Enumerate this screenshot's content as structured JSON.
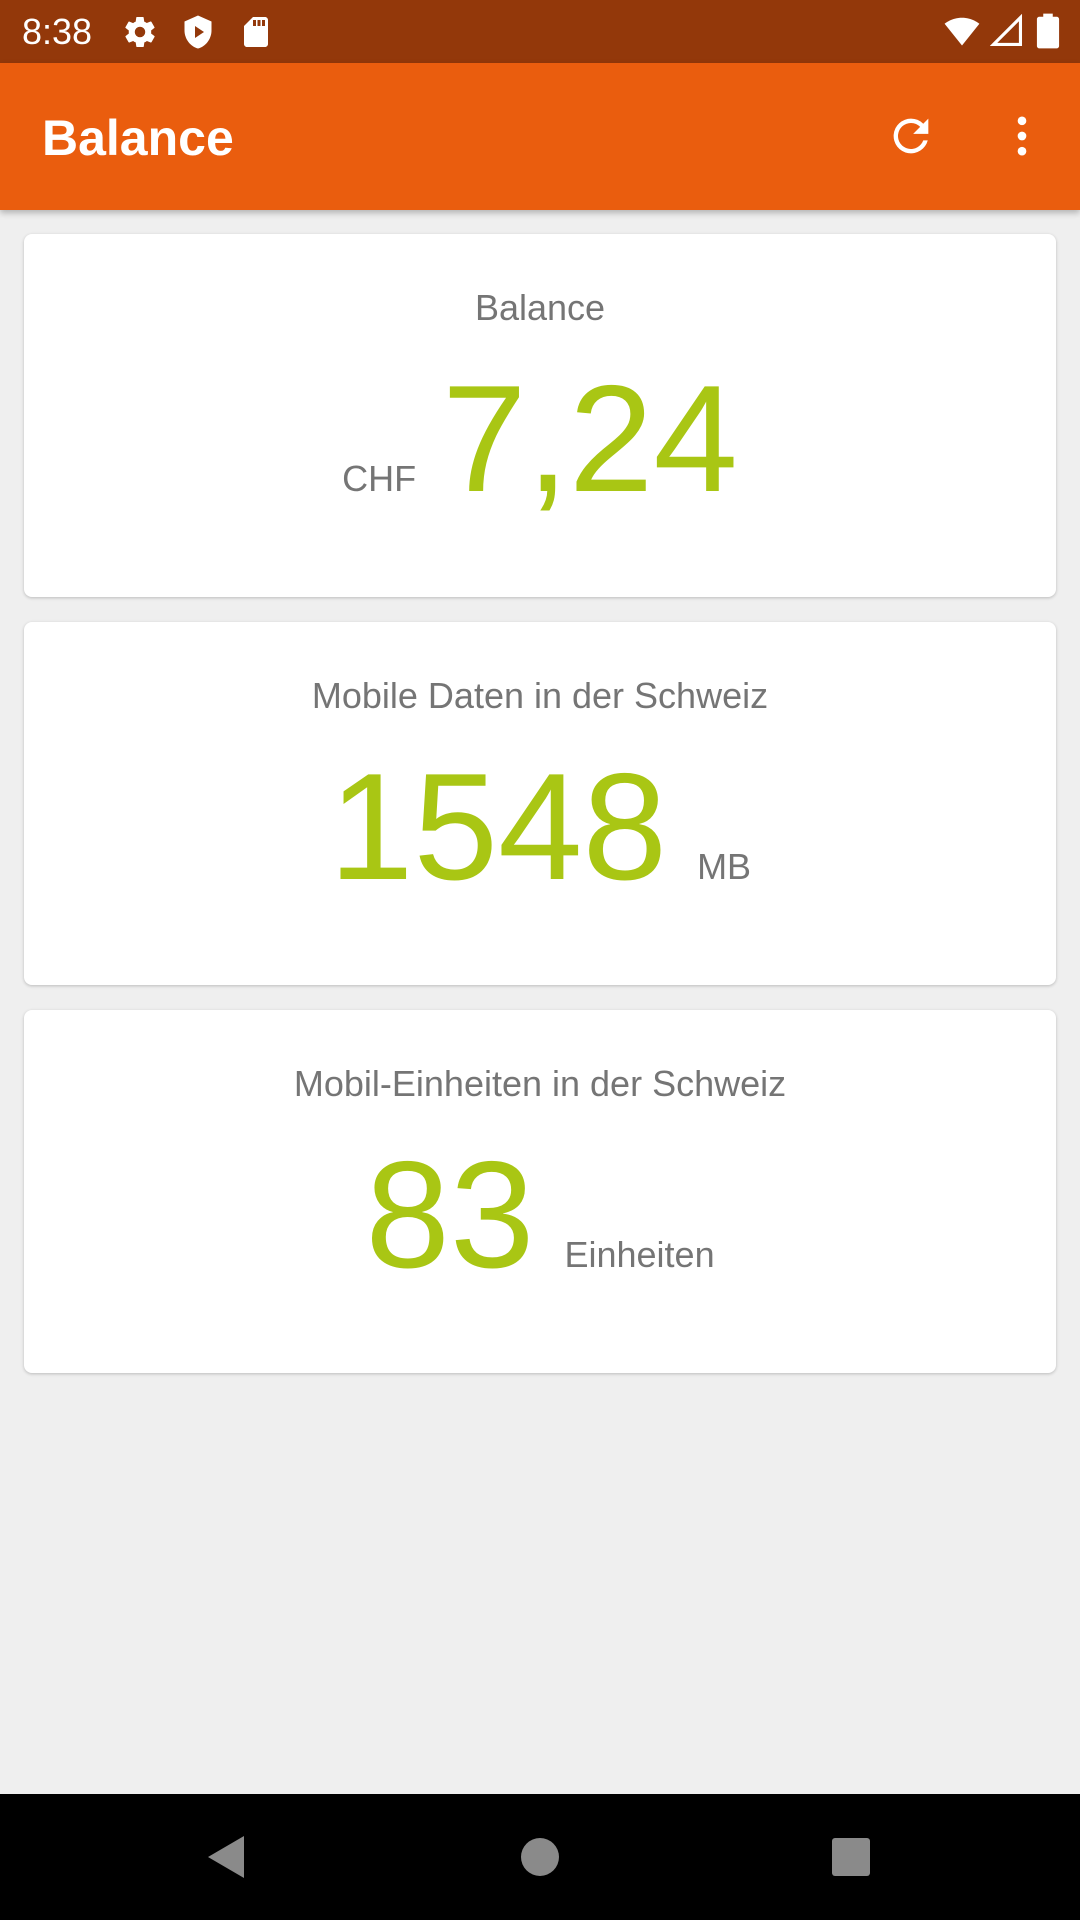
{
  "status_bar": {
    "time": "8:38",
    "icons": [
      "settings-icon",
      "shield-play-icon",
      "sd-card-icon",
      "wifi-icon",
      "cell-signal-icon",
      "battery-icon"
    ]
  },
  "app_bar": {
    "title": "Balance",
    "actions": [
      "refresh-icon",
      "more-vert-icon"
    ]
  },
  "cards": [
    {
      "title": "Balance",
      "prefix_unit": "CHF",
      "value": "7,24",
      "suffix_unit": ""
    },
    {
      "title": "Mobile Daten in der Schweiz",
      "prefix_unit": "",
      "value": "1548",
      "suffix_unit": "MB"
    },
    {
      "title": "Mobil-Einheiten in der Schweiz",
      "prefix_unit": "",
      "value": "83",
      "suffix_unit": "Einheiten"
    }
  ],
  "nav_bar": {
    "buttons": [
      "back-icon",
      "home-icon",
      "recents-icon"
    ]
  },
  "colors": {
    "status_bar": "#93380a",
    "app_bar": "#ea5d0e",
    "value_accent": "#a9c614",
    "label_gray": "#757575",
    "background": "#efefef"
  }
}
